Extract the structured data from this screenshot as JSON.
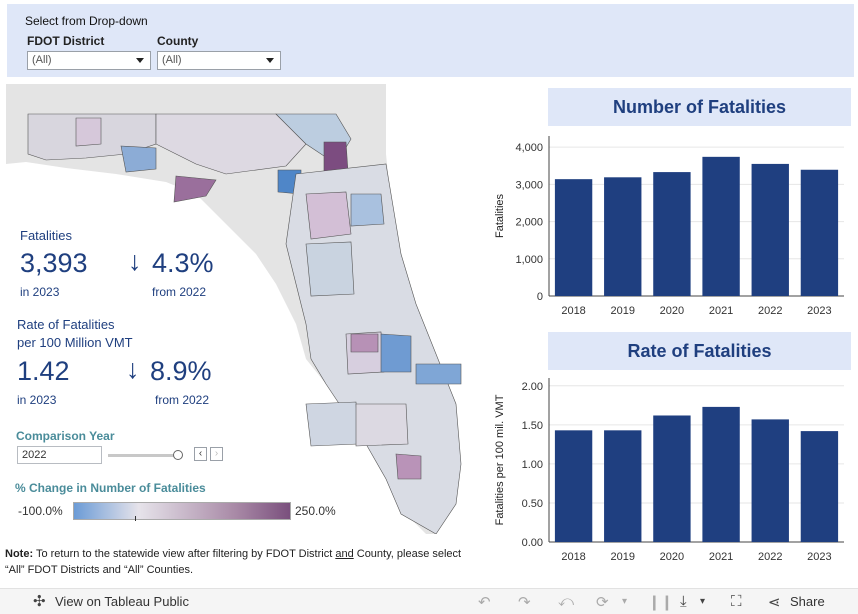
{
  "filter": {
    "title": "Select from Drop-down",
    "district_label": "FDOT District",
    "district_value": "(All)",
    "county_label": "County",
    "county_value": "(All)"
  },
  "kpi": {
    "fatalities_label": "Fatalities",
    "fatalities_value": "3,393",
    "fatalities_year": "in 2023",
    "fatalities_change": "4.3%",
    "fatalities_change_from": "from 2022",
    "rate_label_1": "Rate of Fatalities",
    "rate_label_2": "per 100 Million VMT",
    "rate_value": "1.42",
    "rate_year": "in 2023",
    "rate_change": "8.9%",
    "rate_change_from": "from 2022",
    "arrow_glyph": "↓"
  },
  "comparison": {
    "label": "Comparison Year",
    "value": "2022",
    "slider_position": 1.0
  },
  "legend": {
    "title": "% Change in Number of Fatalities",
    "min_label": "-100.0%",
    "max_label": "250.0%",
    "colors": [
      "#6b9bd6",
      "#e6e3ea",
      "#a889a6",
      "#7a4f7d"
    ]
  },
  "note": {
    "prefix": "Note:",
    "text_1": " To return to the statewide view after filtering by FDOT District ",
    "and": "and",
    "text_2": " County, please select “All” FDOT Districts  and  “All” Counties."
  },
  "chart1_title": "Number of Fatalities",
  "chart2_title": "Rate of Fatalities",
  "chart_data": [
    {
      "type": "bar",
      "title": "Number of Fatalities",
      "ylabel": "Fatalities",
      "categories": [
        "2018",
        "2019",
        "2020",
        "2021",
        "2022",
        "2023"
      ],
      "values": [
        3140,
        3190,
        3330,
        3740,
        3550,
        3393
      ],
      "ylim": [
        0,
        4300
      ],
      "ticks": [
        0,
        1000,
        2000,
        3000,
        4000
      ],
      "tick_labels": [
        "0",
        "1,000",
        "2,000",
        "3,000",
        "4,000"
      ],
      "bar_color": "#1f3f80",
      "grid": true
    },
    {
      "type": "bar",
      "title": "Rate of Fatalities",
      "ylabel": "Fatalities per 100 mil. VMT",
      "categories": [
        "2018",
        "2019",
        "2020",
        "2021",
        "2022",
        "2023"
      ],
      "values": [
        1.43,
        1.43,
        1.62,
        1.73,
        1.57,
        1.42
      ],
      "ylim": [
        0,
        2.1
      ],
      "ticks": [
        0,
        0.5,
        1.0,
        1.5,
        2.0
      ],
      "tick_labels": [
        "0.00",
        "0.50",
        "1.00",
        "1.50",
        "2.00"
      ],
      "bar_color": "#1f3f80",
      "grid": true
    }
  ],
  "footer": {
    "view_label": "View on Tableau Public",
    "share_label": "Share",
    "icons": [
      "tableau-icon",
      "undo-icon",
      "redo-icon",
      "revert-icon",
      "refresh-icon",
      "pause-icon",
      "download-icon",
      "fullscreen-icon",
      "share-icon"
    ]
  }
}
